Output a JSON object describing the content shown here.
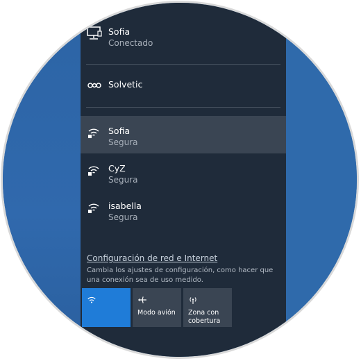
{
  "networks": {
    "connected": {
      "name": "Sofia",
      "status": "Conectado",
      "icon": "ethernet-monitor-icon"
    },
    "vpn": {
      "name": "Solvetic",
      "icon": "vpn-link-icon"
    },
    "wifi": [
      {
        "name": "Sofia",
        "status": "Segura",
        "icon": "wifi-secure-icon",
        "selected": true
      },
      {
        "name": "CyZ",
        "status": "Segura",
        "icon": "wifi-secure-icon",
        "selected": false
      },
      {
        "name": "isabella",
        "status": "Segura",
        "icon": "wifi-secure-icon",
        "selected": false
      }
    ]
  },
  "settings": {
    "link_label": "Configuración de red e Internet",
    "description": "Cambia los ajustes de configuración, como hacer que una conexión sea de uso medido."
  },
  "quick_actions": [
    {
      "label": "",
      "icon": "wifi-icon",
      "active": true
    },
    {
      "label": "Modo avión",
      "icon": "airplane-icon",
      "active": false
    },
    {
      "label": "Zona con cobertura",
      "icon": "hotspot-icon",
      "active": false
    }
  ],
  "colors": {
    "panel_bg": "#1f2b3a",
    "selected_bg": "#3a4553",
    "accent": "#1f7cd8",
    "desktop_bg": "#2f6aab"
  }
}
